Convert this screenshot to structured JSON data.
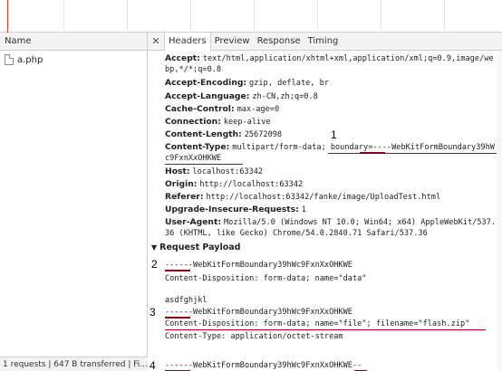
{
  "left_panel": {
    "column_header": "Name",
    "files": [
      {
        "name": "a.php"
      }
    ],
    "status": "1 requests | 647 B transferred | Fi..."
  },
  "detail_panel": {
    "tabs": [
      {
        "label": "Headers",
        "active": true
      },
      {
        "label": "Preview",
        "active": false
      },
      {
        "label": "Response",
        "active": false
      },
      {
        "label": "Timing",
        "active": false
      }
    ],
    "request_headers": [
      {
        "name": "Accept:",
        "value": "text/html,application/xhtml+xml,application/xml;q=0.9,image/we",
        "value_cont": "bp,*/*;q=0.8"
      },
      {
        "name": "Accept-Encoding:",
        "value": "gzip, deflate, br"
      },
      {
        "name": "Accept-Language:",
        "value": "zh-CN,zh;q=0.8"
      },
      {
        "name": "Cache-Control:",
        "value": "max-age=0"
      },
      {
        "name": "Connection:",
        "value": "keep-alive"
      },
      {
        "name": "Content-Length:",
        "value": "25672098"
      },
      {
        "name": "Content-Type:",
        "value": "multipart/form-data; boundary=----WebKitFormBoundary39hW",
        "value_cont": "c9FxnXxOHKWE"
      },
      {
        "name": "Host:",
        "value": "localhost:63342"
      },
      {
        "name": "Origin:",
        "value": "http://localhost:63342"
      },
      {
        "name": "Referer:",
        "value": "http://localhost:63342/fanke/image/UploadTest.html"
      },
      {
        "name": "Upgrade-Insecure-Requests:",
        "value": "1"
      },
      {
        "name": "User-Agent:",
        "value": "Mozilla/5.0 (Windows NT 10.0; Win64; x64) AppleWebKit/537.",
        "value_cont": "36 (KHTML, like Gecko) Chrome/54.0.2840.71 Safari/537.36"
      }
    ],
    "payload_section_title": "Request Payload",
    "payload_lines": [
      "------WebKitFormBoundary39hWc9FxnXxOHKWE",
      "Content-Disposition: form-data; name=\"data\"",
      "",
      "asdfghjkl",
      "------WebKitFormBoundary39hWc9FxnXxOHKWE",
      "Content-Disposition: form-data; name=\"file\"; filename=\"flash.zip\"",
      "Content-Type: application/octet-stream",
      "",
      "",
      "------WebKitFormBoundary39hWc9FxnXxOHKWE--"
    ],
    "annotations": [
      "1",
      "2",
      "3",
      "4"
    ]
  },
  "colors": {
    "annotation_underline": "#c0001a",
    "timeline_marker": "#e5402a"
  }
}
